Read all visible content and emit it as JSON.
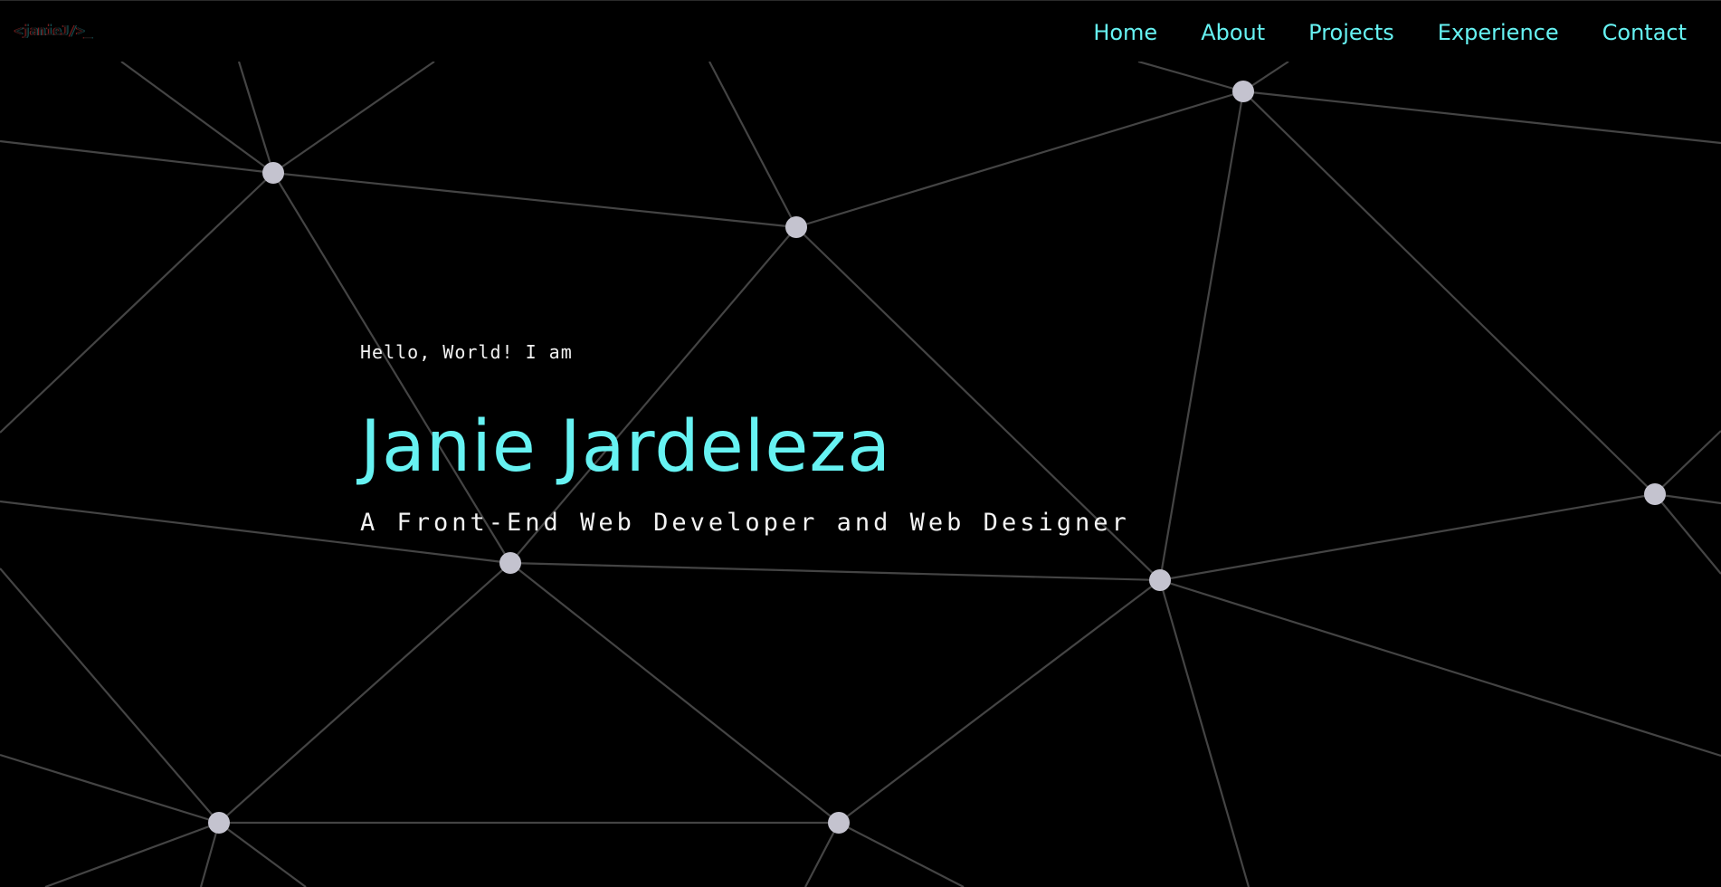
{
  "header": {
    "logo_text": "<janieJ/>_",
    "nav": [
      {
        "label": "Home"
      },
      {
        "label": "About"
      },
      {
        "label": "Projects"
      },
      {
        "label": "Experience"
      },
      {
        "label": "Contact"
      }
    ]
  },
  "hero": {
    "greeting": "Hello, World! I am",
    "name": "Janie Jardeleza",
    "tagline": "A Front-End Web Developer and Web Designer"
  },
  "colors": {
    "background": "#000000",
    "accent": "#66f2f2",
    "text": "#f3f3f3",
    "network_line": "#444444",
    "network_node": "#c4c3cf"
  }
}
